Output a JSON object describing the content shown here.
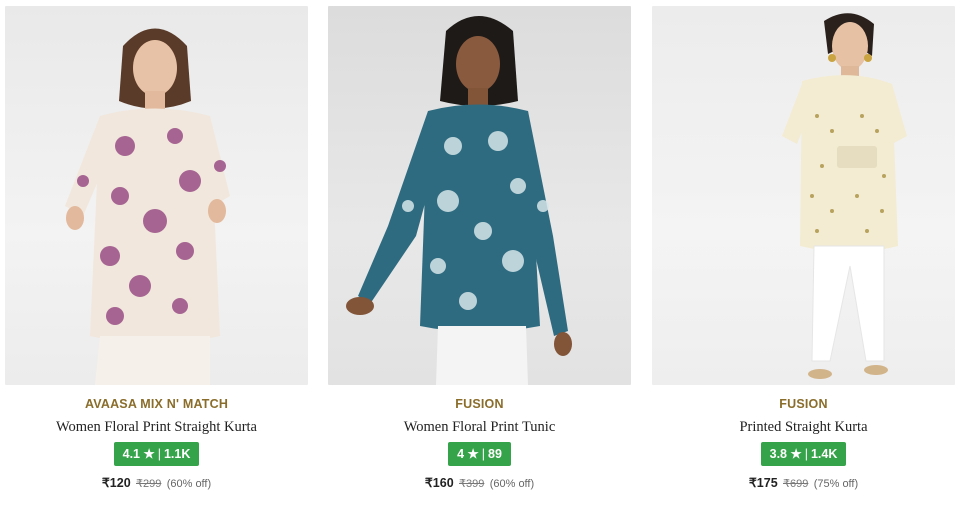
{
  "products": [
    {
      "brand": "AVAASA MIX N' MATCH",
      "title": "Women Floral Print Straight Kurta",
      "rating": "4.1",
      "star": "★",
      "reviews": "1.1K",
      "price": "₹120",
      "mrp": "₹299",
      "discount": "(60% off)",
      "image_icon": "model-photo-floral-kurta"
    },
    {
      "brand": "FUSION",
      "title": "Women Floral Print Tunic",
      "rating": "4",
      "star": "★",
      "reviews": "89",
      "price": "₹160",
      "mrp": "₹399",
      "discount": "(60% off)",
      "image_icon": "model-photo-teal-tunic"
    },
    {
      "brand": "FUSION",
      "title": "Printed Straight Kurta",
      "rating": "3.8",
      "star": "★",
      "reviews": "1.4K",
      "price": "₹175",
      "mrp": "₹699",
      "discount": "(75% off)",
      "image_icon": "model-photo-cream-kurta"
    }
  ],
  "colors": {
    "brand_text": "#8a6d2a",
    "rating_badge": "#35a349"
  }
}
